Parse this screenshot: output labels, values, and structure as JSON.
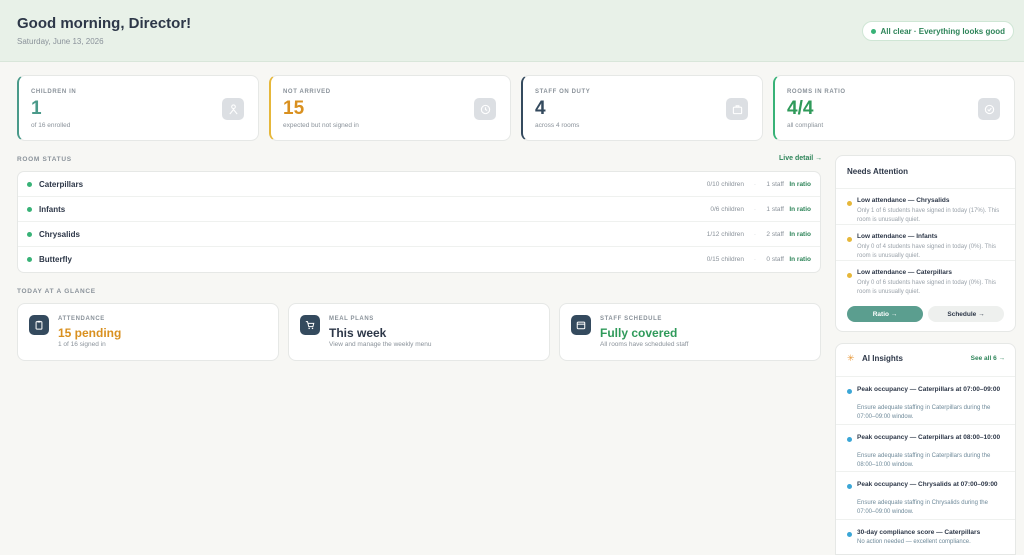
{
  "header": {
    "greeting": "Good morning, Director!",
    "date": "Saturday, June 13, 2026",
    "status": "All clear · Everything looks good",
    "status_color": "#38b277"
  },
  "stats": [
    {
      "label": "CHILDREN IN",
      "value": "1",
      "sub": "of 16 enrolled",
      "accent": "#4a9a8a",
      "icon": "child-icon"
    },
    {
      "label": "NOT ARRIVED",
      "value": "15",
      "sub": "expected but not signed in",
      "accent": "#e6b73a",
      "icon": "clock-icon"
    },
    {
      "label": "STAFF ON DUTY",
      "value": "4",
      "sub": "across 4 rooms",
      "accent": "#344a5e",
      "icon": "briefcase-icon"
    },
    {
      "label": "ROOMS IN RATIO",
      "value": "4/4",
      "sub": "all compliant",
      "accent": "#38b277",
      "icon": "check-circle-icon"
    }
  ],
  "room_status": {
    "label": "ROOM STATUS",
    "live_detail": "Live detail →",
    "rooms": [
      {
        "name": "Caterpillars",
        "children": "0/10 children",
        "staff": "1 staff",
        "status": "In ratio"
      },
      {
        "name": "Infants",
        "children": "0/6 children",
        "staff": "1 staff",
        "status": "In ratio"
      },
      {
        "name": "Chrysalids",
        "children": "1/12 children",
        "staff": "2 staff",
        "status": "In ratio"
      },
      {
        "name": "Butterfly",
        "children": "0/15 children",
        "staff": "0 staff",
        "status": "In ratio"
      }
    ]
  },
  "glance": {
    "label": "TODAY AT A GLANCE",
    "cards": [
      {
        "label": "ATTENDANCE",
        "value": "15 pending",
        "sub": "1 of 16 signed in",
        "color": "#d9901f",
        "icon": "clipboard-icon"
      },
      {
        "label": "MEAL PLANS",
        "value": "This week",
        "sub": "View and manage the weekly menu",
        "color": "#2d3748",
        "icon": "cart-icon"
      },
      {
        "label": "STAFF SCHEDULE",
        "value": "Fully covered",
        "sub": "All rooms have scheduled staff",
        "color": "#2f9a5a",
        "icon": "calendar-icon"
      }
    ]
  },
  "needs_attention": {
    "title": "Needs Attention",
    "items": [
      {
        "title": "Low attendance — Chrysalids",
        "desc": "Only 1 of 6 students have signed in today (17%). This room is unusually quiet."
      },
      {
        "title": "Low attendance — Infants",
        "desc": "Only 0 of 4 students have signed in today (0%). This room is unusually quiet."
      },
      {
        "title": "Low attendance — Caterpillars",
        "desc": "Only 0 of 6 students have signed in today (0%). This room is unusually quiet."
      }
    ],
    "ratio_button": "Ratio →",
    "schedule_button": "Schedule →"
  },
  "ai_insights": {
    "title": "AI Insights",
    "see_all": "See all 6 →",
    "items": [
      {
        "title": "Peak occupancy — Caterpillars at 07:00–09:00",
        "desc": "Ensure adequate staffing in Caterpillars during the 07:00–09:00 window."
      },
      {
        "title": "Peak occupancy — Caterpillars at 08:00–10:00",
        "desc": "Ensure adequate staffing in Caterpillars during the 08:00–10:00 window."
      },
      {
        "title": "Peak occupancy — Chrysalids at 07:00–09:00",
        "desc": "Ensure adequate staffing in Chrysalids during the 07:00–09:00 window."
      },
      {
        "title": "30-day compliance score — Caterpillars",
        "desc": "No action needed — excellent compliance."
      }
    ]
  }
}
